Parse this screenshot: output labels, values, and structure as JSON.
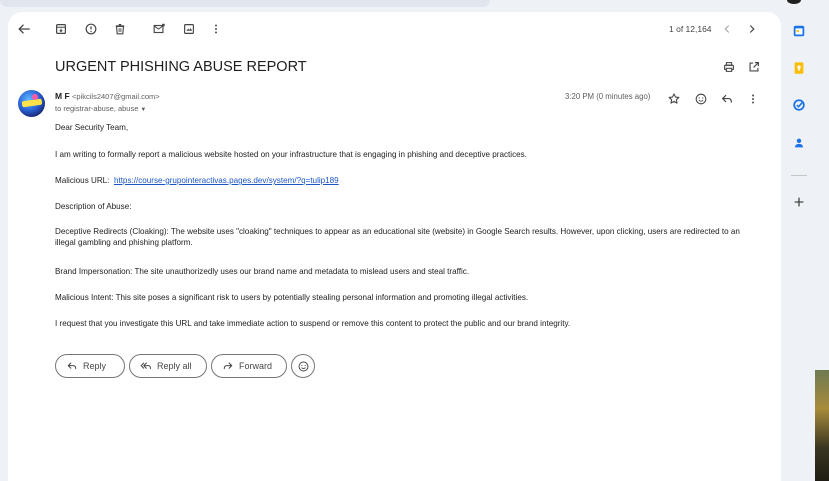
{
  "toolbar": {
    "back_icon": "arrow-left-icon",
    "archive_icon": "archive-icon",
    "spam_icon": "report-spam-icon",
    "delete_icon": "trash-icon",
    "mark_unread_icon": "mark-unread-icon",
    "snooze_icon": "move-to-icon",
    "more_icon": "more-vert-icon"
  },
  "pager": {
    "text": "1 of 12,164"
  },
  "email": {
    "subject": "URGENT PHISHING ABUSE REPORT",
    "sender_name": "M F",
    "sender_email": "<pikcils2407@gmail.com>",
    "to": "to registrar-abuse, abuse",
    "time": "3:20 PM (0 minutes ago)",
    "body": {
      "greeting": "Dear Security Team,",
      "p1": "I am writing to formally report a malicious website hosted on your infrastructure that is engaging in phishing and deceptive practices.",
      "url_label": "Malicious URL:",
      "url": "https://course-grupointeractivas.pages.dev/system/?q=tulip189",
      "description_heading": "Description of Abuse:",
      "p2": "Deceptive Redirects (Cloaking): The website uses \"cloaking\" techniques to appear as an educational site (website) in Google Search results. However, upon clicking, users are redirected to an illegal gambling and phishing platform.",
      "p3": "Brand Impersonation: The site unauthorizedly uses our brand name and metadata to mislead users and steal traffic.",
      "p4": "Malicious Intent: This site poses a significant risk to users by potentially stealing personal information and promoting illegal activities.",
      "p5": "I request that you investigate this URL and take immediate action to suspend or remove this content to protect the public and our brand integrity."
    }
  },
  "actions": {
    "reply": "Reply",
    "reply_all": "Reply all",
    "forward": "Forward"
  },
  "colors": {
    "link": "#1a55c7",
    "calendar": "#1a73e8",
    "keep": "#fbbc04",
    "tasks": "#1a73e8",
    "contacts": "#1a73e8"
  }
}
